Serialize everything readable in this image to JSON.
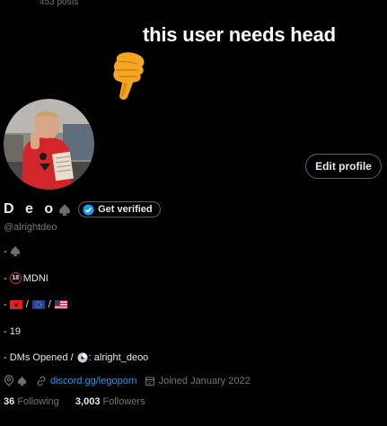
{
  "header": {
    "post_count": "453 posts"
  },
  "banner": {
    "text": "this user needs head",
    "emoji": "pointing-down-hand"
  },
  "profile": {
    "edit_button": "Edit profile",
    "display_name": "D e o",
    "name_emoji": "spade-icon",
    "verify_button": "Get verified",
    "handle": "@alrightdeo"
  },
  "bio": {
    "line1_prefix": "- ",
    "line2_prefix": "- ",
    "line2_badge": "18",
    "line2_text": "MDNI",
    "line3_prefix": "- ",
    "line3_sep": "/",
    "line4": "- 19",
    "line5_prefix": "- DMs Opened /",
    "line5_text": ": alright_deoo"
  },
  "meta": {
    "location_emoji": "spade-icon",
    "website": "discord.gg/legoporn",
    "joined": "Joined January 2022"
  },
  "stats": {
    "following_count": "36",
    "following_label": "Following",
    "followers_count": "3,003",
    "followers_label": "Followers"
  },
  "colors": {
    "accent": "#1d9bf0",
    "muted": "#71767b",
    "text": "#e7e9ea",
    "bg": "#000000"
  }
}
